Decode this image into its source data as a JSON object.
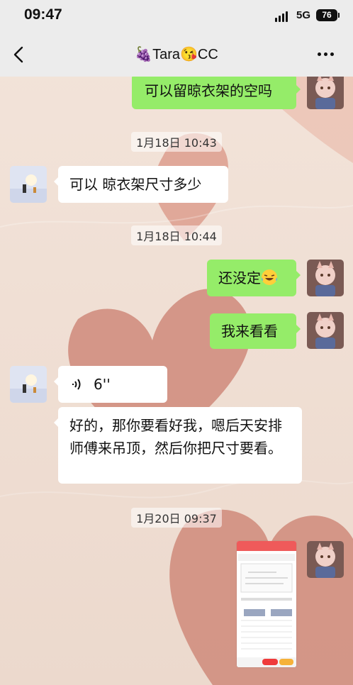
{
  "status_bar": {
    "time": "09:47",
    "network": "5G",
    "battery": "76"
  },
  "nav": {
    "title": "🍇Tara😘CC",
    "back_icon": "chevron-left-icon",
    "more_icon": "more-dots-icon"
  },
  "colors": {
    "outgoing_bubble": "#95ec69",
    "incoming_bubble": "#ffffff",
    "bar_bg": "#ececec"
  },
  "messages": [
    {
      "side": "out",
      "type": "text",
      "text": "可以留晾衣架的空吗"
    },
    {
      "type": "timestamp",
      "text": "1月18日 10:43"
    },
    {
      "side": "in",
      "type": "text",
      "text": "可以 晾衣架尺寸多少"
    },
    {
      "type": "timestamp",
      "text": "1月18日 10:44"
    },
    {
      "side": "out",
      "type": "text",
      "text": "还没定",
      "emoji": "laughing-tears-emoji"
    },
    {
      "side": "out",
      "type": "text",
      "text": "我来看看"
    },
    {
      "side": "in",
      "type": "voice",
      "duration": "6''"
    },
    {
      "side": "in",
      "type": "text",
      "text": "好的，那你要看好我，嗯后天安排师傅来吊顶，然后你把尺寸要看。"
    },
    {
      "type": "timestamp",
      "text": "1月20日 09:37"
    },
    {
      "side": "out",
      "type": "image",
      "description": "screenshot-thumbnail"
    }
  ]
}
